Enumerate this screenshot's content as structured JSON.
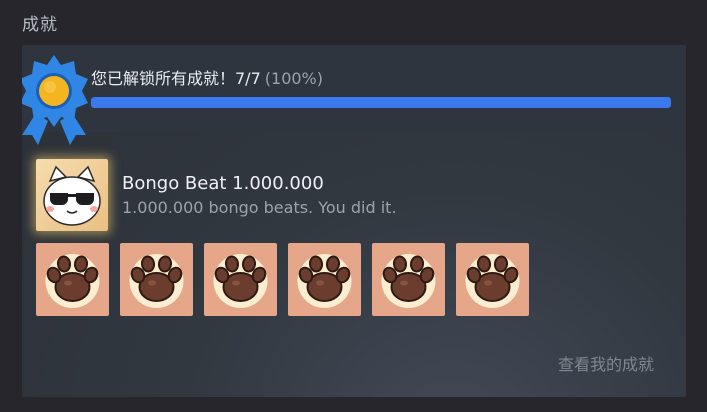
{
  "section": {
    "title": "成就"
  },
  "summary": {
    "unlocked_text": "您已解锁所有成就！7/7",
    "percent_text": "(100%)",
    "progress_fraction": 1.0
  },
  "featured": {
    "title": "Bongo Beat 1.000.000",
    "description": "1.000.000 bongo beats. You did it.",
    "icon": "cat-sunglasses-icon"
  },
  "achievement_icons": [
    {
      "icon": "paw-icon"
    },
    {
      "icon": "paw-icon"
    },
    {
      "icon": "paw-icon"
    },
    {
      "icon": "paw-icon"
    },
    {
      "icon": "paw-icon"
    },
    {
      "icon": "paw-icon"
    }
  ],
  "footer": {
    "view_link": "查看我的成就"
  },
  "colors": {
    "accent": "#3a79ec",
    "medal_blue": "#2f86e4",
    "medal_gold": "#f4b520",
    "tile_bg": "#e5a68a"
  }
}
